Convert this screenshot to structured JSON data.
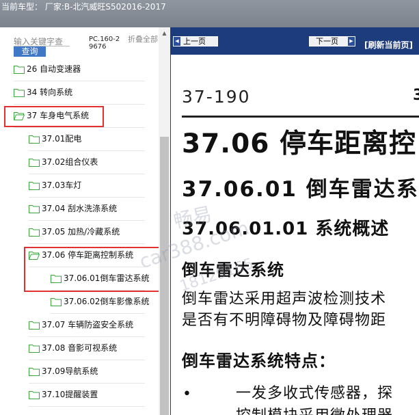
{
  "window": {
    "title": "当前车型：  厂家:B-北汽威旺S502016-2017"
  },
  "sidebar": {
    "search_placeholder": "输入关键字查",
    "search_button": "查询",
    "pc_code": "PC.160-29676",
    "collapse_all": "折叠全部",
    "items": [
      {
        "label": "26 自动变速器",
        "level": 1
      },
      {
        "label": "34 转向系统",
        "level": 1
      },
      {
        "label": "37 车身电气系统",
        "level": 1,
        "expanded": true,
        "highlighted": true
      },
      {
        "label": "37.01配电",
        "level": 2
      },
      {
        "label": "37.02组合仪表",
        "level": 2
      },
      {
        "label": "37.03车灯",
        "level": 2
      },
      {
        "label": "37.04 刮水洗涤系统",
        "level": 2
      },
      {
        "label": "37.05 加热/冷藏系统",
        "level": 2
      },
      {
        "label": "37.06 停车距离控制系统",
        "level": 2,
        "expanded": true,
        "highlighted": true
      },
      {
        "label": "37.06.01倒车雷达系统",
        "level": 3,
        "selected": true
      },
      {
        "label": "37.06.02倒车影像系统",
        "level": 3
      },
      {
        "label": "37.07 车辆防盗安全系统",
        "level": 2
      },
      {
        "label": "37.08 音影可视系统",
        "level": 2
      },
      {
        "label": "37.09导航系统",
        "level": 2
      },
      {
        "label": "37.10提醒装置",
        "level": 2
      }
    ]
  },
  "toolbar": {
    "prev_label": "上一页",
    "next_label": "下一页",
    "refresh_label": "[刷新当前页]"
  },
  "document": {
    "page_number": "37-190",
    "page_number_right": "3",
    "h1": "37.06 停车距离控",
    "h2": "37.06.01 倒车雷达系",
    "h3": "37.06.01.01 系统概述",
    "section1_title": "倒车雷达系统",
    "para_line1": "倒车雷达采用超声波检测技术",
    "para_line2": "是否有不明障碍物及障碍物距",
    "section2_title": "倒车雷达系统特点：",
    "bullet_symbol": "•",
    "bullet_line1": "一发多收式传感器，探",
    "bullet_line2": "控制模块采用微处理器"
  },
  "watermark": {
    "line1": "畅易",
    "line2": "car388.com",
    "line3": "18129165"
  },
  "colors": {
    "title_bar": "#8f96a0",
    "toolbar_bg": "#1d3c7c",
    "highlight_box": "#e03030",
    "folder_icon": "#3aa63a",
    "search_button_bg": "#3e78c7"
  },
  "icons": {
    "folder": "folder-icon",
    "prev_arrow": "arrow-left-icon",
    "next_arrow": "arrow-right-icon",
    "scroll_up": "scroll-up-icon"
  }
}
